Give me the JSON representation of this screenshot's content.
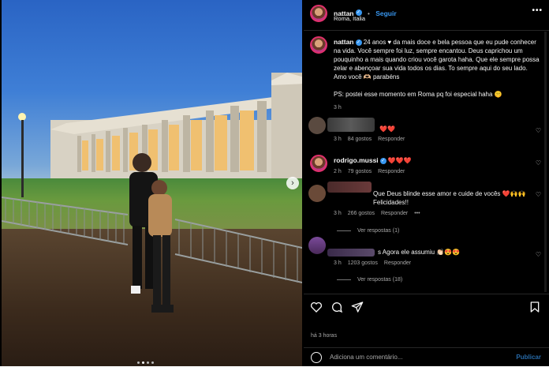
{
  "colors": {
    "accent": "#3897f0",
    "heart": "#ff3040",
    "background": "#000000"
  },
  "header": {
    "username": "nattan",
    "separator": "•",
    "follow_label": "Seguir",
    "location": "Roma, Italia",
    "more_icon": "more-icon"
  },
  "caption": {
    "username": "nattan",
    "text": "24 anos ♥ da mais doce e bela pessoa que eu pude conhecer na vida. Você sempre foi luz, sempre encantou. Deus caprichou um pouquinho a mais quando criou você garota haha. Que ele sempre possa zelar e abençoar sua vida todos os dias. To sempre aqui do seu lado. Amo você 🫶🏼 parabéns",
    "ps": "PS: postei esse momento em Roma pq foi especial haha 🤫",
    "time": "3 h"
  },
  "comments": [
    {
      "username": "",
      "text": "❤️❤️",
      "time": "3 h",
      "likes": "84 gostos",
      "reply": "Responder"
    },
    {
      "username": "rodrigo.mussi",
      "text": "❤️❤️❤️",
      "time": "2 h",
      "likes": "79 gostos",
      "reply": "Responder"
    },
    {
      "username": "",
      "text": "Que Deus blinde esse amor e cuide de vocês ❤️🙌🙌 Felicidades!!",
      "time": "3 h",
      "likes": "266 gostos",
      "reply": "Responder",
      "more": "•••",
      "view_replies": "Ver respostas (1)"
    },
    {
      "username": "",
      "text": "s Agora ele assumiu 👏🏻😍😍",
      "time": "3 h",
      "likes": "1203 gostos",
      "reply": "Responder",
      "view_replies": "Ver respostas (18)"
    }
  ],
  "footer": {
    "posted": "há 3 horas",
    "add_comment_placeholder": "Adiciona um comentário...",
    "publish_label": "Publicar"
  }
}
